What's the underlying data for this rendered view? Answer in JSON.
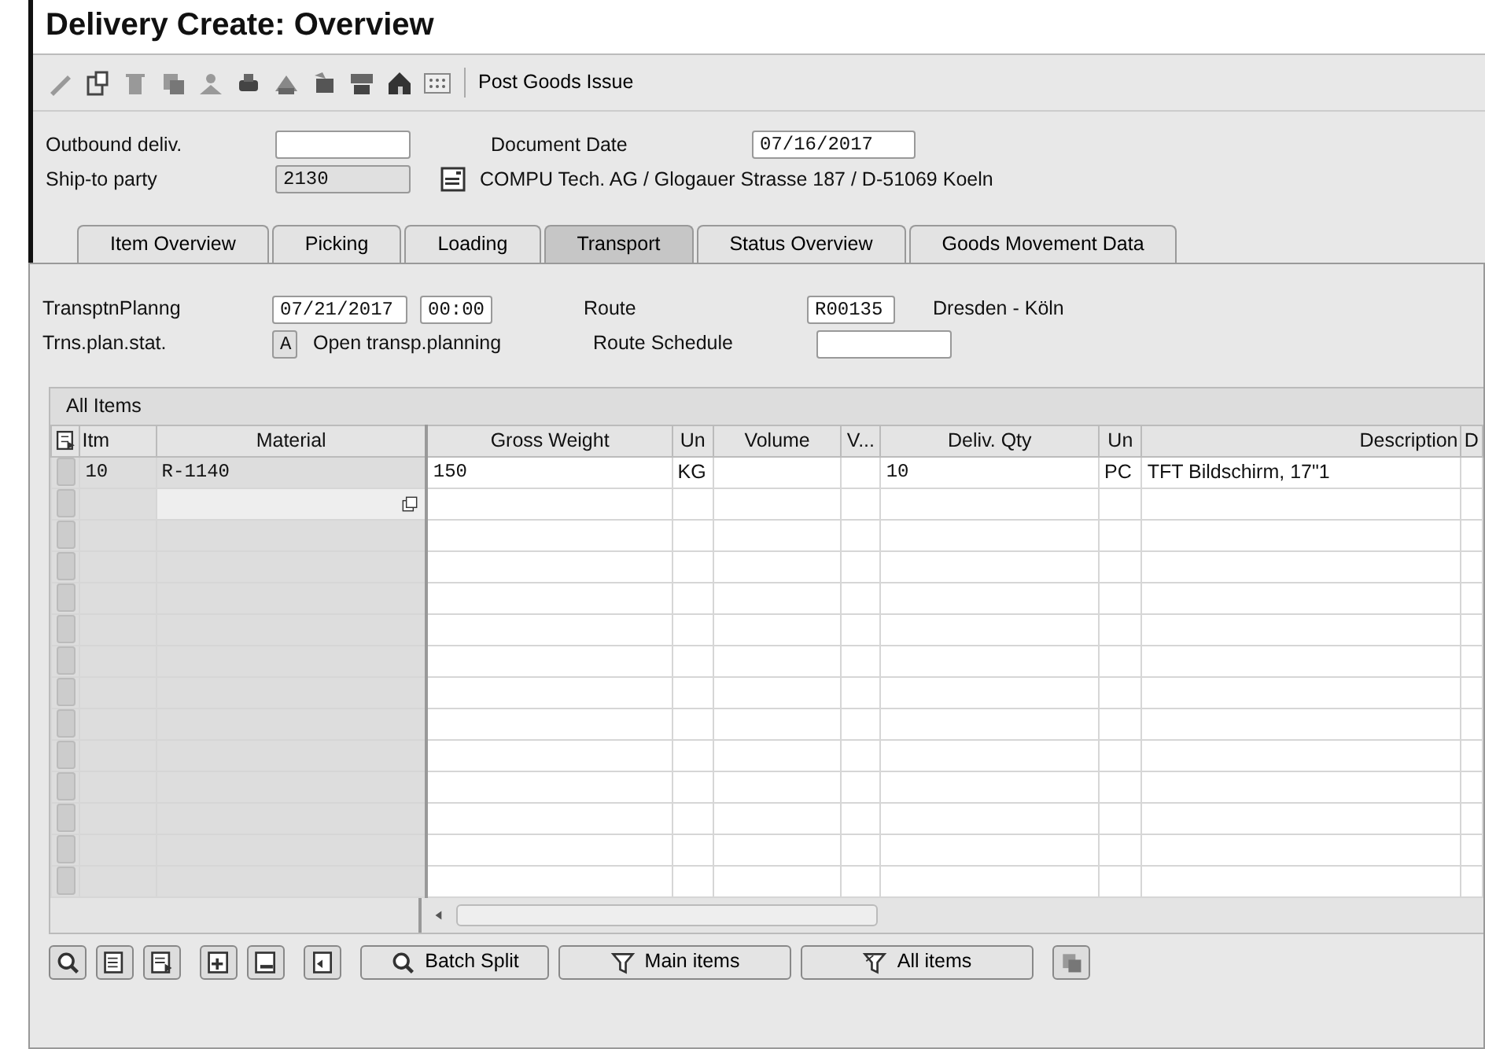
{
  "window": {
    "title": "Delivery  Create: Overview"
  },
  "toolbar": {
    "button": "Post Goods Issue"
  },
  "header": {
    "fields": [
      {
        "label": "Outbound deliv.",
        "editable": true
      },
      {
        "label": "Document Date",
        "value": "07/16/2017",
        "editable": true
      },
      {
        "label": "Ship-to party",
        "value": "2130",
        "editable": false,
        "description": "COMPU Tech. AG / Glogauer Strasse 187 / D-51069 Koeln"
      }
    ]
  },
  "tabs": [
    {
      "label": "Item Overview",
      "selected": false
    },
    {
      "label": "Picking",
      "selected": false
    },
    {
      "label": "Loading",
      "selected": false
    },
    {
      "label": "Transport",
      "selected": true
    },
    {
      "label": "Status Overview",
      "selected": false
    },
    {
      "label": "Goods Movement Data",
      "selected": false
    }
  ],
  "transport": {
    "planning_label": "TransptnPlanng",
    "planning_date": "07/21/2017",
    "planning_time": "00:00",
    "route_label": "Route",
    "route": "R00135",
    "route_text": "Dresden - Köln",
    "status_label": "Trns.plan.stat.",
    "status": "A",
    "status_text": "Open transp.planning",
    "schedule_label": "Route Schedule"
  },
  "table": {
    "title": "All Items",
    "columns": [
      "Itm",
      "Material",
      "Gross Weight",
      "Un",
      "Volume",
      "V...",
      "Deliv. Qty",
      "Un",
      "Description",
      "D"
    ],
    "rows": [
      {
        "cells": [
          "10",
          "R-1140",
          "150",
          "KG",
          null,
          null,
          "10",
          "PC",
          "TFT Bildschirm, 17\"1",
          null
        ]
      }
    ]
  },
  "bottom_buttons": [
    {
      "kind": "icon"
    },
    {
      "kind": "icon"
    },
    {
      "kind": "icon"
    },
    {
      "kind": "icon"
    },
    {
      "kind": "icon"
    },
    {
      "kind": "icon"
    },
    {
      "kind": "text",
      "label": "Batch Split"
    },
    {
      "kind": "text",
      "label": "Main items"
    },
    {
      "kind": "text",
      "label": "All items"
    },
    {
      "kind": "icon"
    }
  ]
}
